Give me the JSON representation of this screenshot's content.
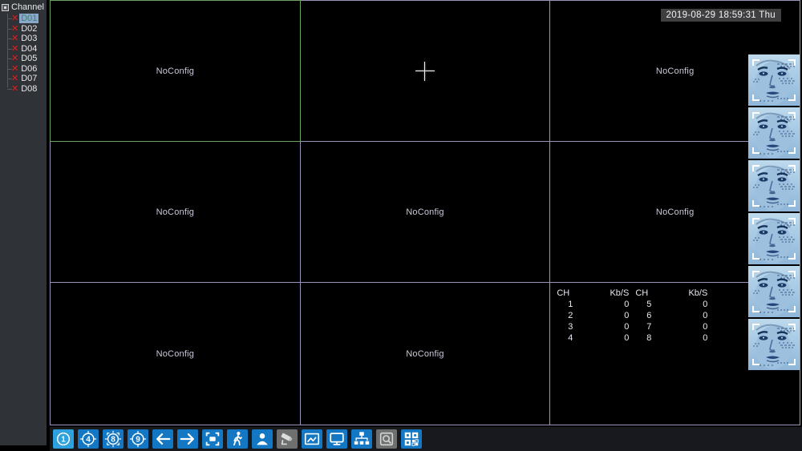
{
  "sidebar": {
    "header": "Channel",
    "channels": [
      {
        "id": "D01",
        "selected": true
      },
      {
        "id": "D02",
        "selected": false
      },
      {
        "id": "D03",
        "selected": false
      },
      {
        "id": "D04",
        "selected": false
      },
      {
        "id": "D05",
        "selected": false
      },
      {
        "id": "D06",
        "selected": false
      },
      {
        "id": "D07",
        "selected": false
      },
      {
        "id": "D08",
        "selected": false
      }
    ],
    "offline_mark": "✕"
  },
  "timestamp": "2019-08-29 18:59:31 Thu",
  "grid": {
    "layout": "3x3",
    "cells": [
      {
        "label": "NoConfig",
        "selected": true
      },
      {
        "label": "",
        "cursor": "crosshair"
      },
      {
        "label": "NoConfig"
      },
      {
        "label": "NoConfig"
      },
      {
        "label": "NoConfig"
      },
      {
        "label": "NoConfig"
      },
      {
        "label": "NoConfig"
      },
      {
        "label": "NoConfig"
      },
      {
        "label": "",
        "overlay": "bitrate-table"
      }
    ]
  },
  "bitrate_table": {
    "headers": [
      "CH",
      "Kb/S",
      "CH",
      "Kb/S"
    ],
    "rows": [
      [
        "1",
        "0",
        "5",
        "0"
      ],
      [
        "2",
        "0",
        "6",
        "0"
      ],
      [
        "3",
        "0",
        "7",
        "0"
      ],
      [
        "4",
        "0",
        "8",
        "0"
      ]
    ]
  },
  "face_panel": {
    "thumbnail_count": 6,
    "description": "face-detection-snapshots"
  },
  "toolbar": {
    "buttons": [
      {
        "name": "view-single",
        "label": "1",
        "state": "active"
      },
      {
        "name": "view-quad",
        "label": "4",
        "state": "normal"
      },
      {
        "name": "view-eight",
        "label": "8",
        "state": "normal"
      },
      {
        "name": "view-nine",
        "label": "9",
        "state": "normal"
      },
      {
        "name": "page-previous",
        "icon": "arrow-left",
        "state": "normal"
      },
      {
        "name": "page-next",
        "icon": "arrow-right",
        "state": "normal"
      },
      {
        "name": "fullscreen",
        "icon": "focus-square",
        "state": "normal"
      },
      {
        "name": "motion-detect",
        "icon": "walking-person",
        "state": "normal"
      },
      {
        "name": "face-detect",
        "icon": "person-bust",
        "state": "normal"
      },
      {
        "name": "ptz-control",
        "icon": "ptz-camera",
        "state": "disabled"
      },
      {
        "name": "image-color",
        "icon": "picture-frame",
        "state": "normal"
      },
      {
        "name": "output-adjust",
        "icon": "monitor",
        "state": "normal"
      },
      {
        "name": "network",
        "icon": "network-tree",
        "state": "normal"
      },
      {
        "name": "storage-search",
        "icon": "disk-search",
        "state": "disabled"
      },
      {
        "name": "channel-matrix",
        "icon": "qr-grid",
        "state": "normal"
      }
    ]
  },
  "colors": {
    "grid_line": "#9d93bd",
    "selected_border": "#69a35f",
    "button_blue": "#1377c3",
    "button_active": "#2ea0dc",
    "button_disabled": "#6e7070",
    "offline_red": "#d32626",
    "sidebar_bg": "#2f3237",
    "toolbar_bg": "#17191f"
  }
}
